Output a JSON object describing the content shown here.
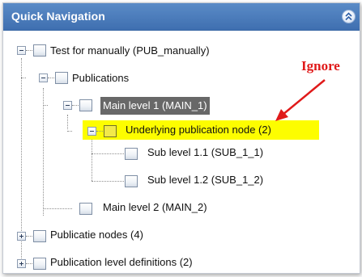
{
  "panel": {
    "title": "Quick Navigation"
  },
  "tree": {
    "root": "Test for manually (PUB_manually)",
    "publications": "Publications",
    "main_level_1": "Main level 1 (MAIN_1)",
    "underlying_node": "Underlying publication node (2)",
    "sub_level_1_1": "Sub level 1.1 (SUB_1_1)",
    "sub_level_1_2": "Sub level 1.2 (SUB_1_2)",
    "main_level_2": "Main level 2 (MAIN_2)",
    "publicatie_nodes": "Publicatie nodes (4)",
    "publication_level_definitions": "Publication level definitions (2)"
  },
  "annotation": {
    "text": "Ignore",
    "color": "#e01a1a"
  },
  "colors": {
    "header": "#4a7cbd",
    "selected": "#686868",
    "highlight": "#fdfd00"
  },
  "icons": {
    "collapse": "double-chevron-up-icon",
    "node": "folder-node-icon",
    "expander_expanded": "minus-box-icon",
    "expander_collapsed": "plus-box-icon"
  }
}
